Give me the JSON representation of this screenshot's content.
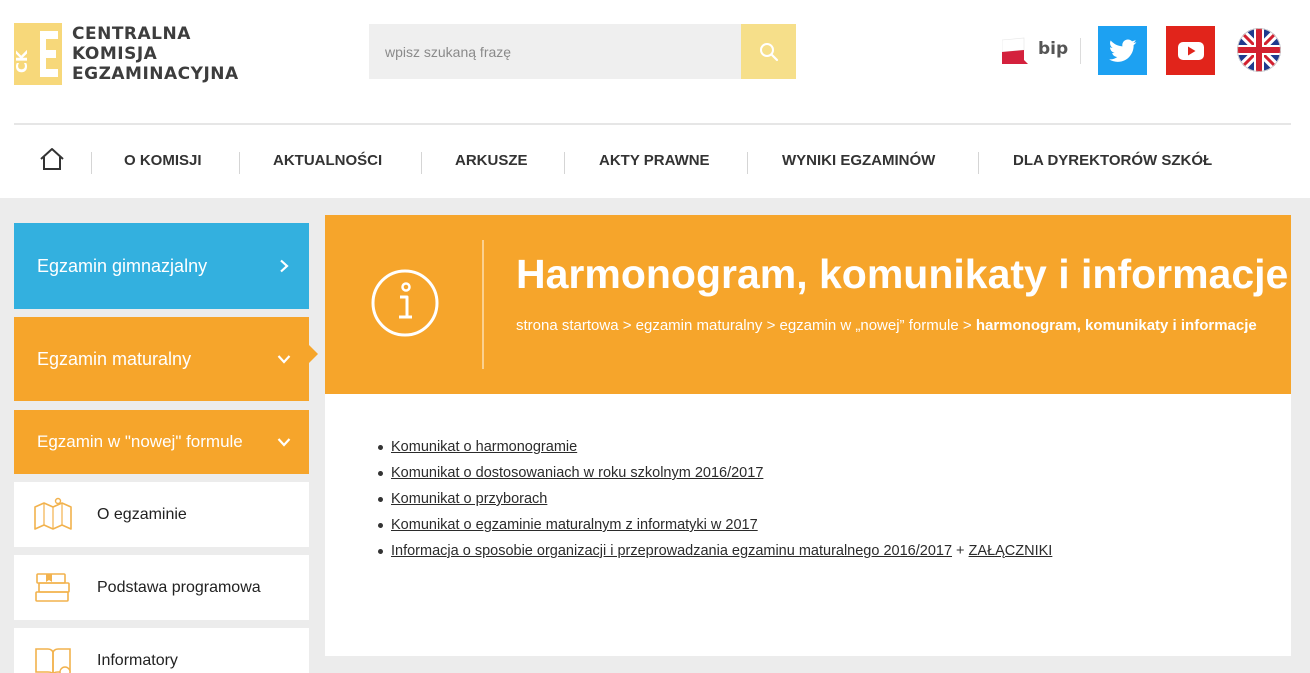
{
  "logo": {
    "mark": "CK",
    "line1": "CENTRALNA",
    "line2": "KOMISJA",
    "line3": "EGZAMINACYJNA",
    "yellow": "#f7d87a"
  },
  "search": {
    "placeholder": "wpisz szukaną frazę",
    "value": "",
    "icon": "search-icon"
  },
  "header_links": {
    "bip_label": "bip",
    "twitter_icon": "twitter-icon",
    "youtube_icon": "youtube-icon",
    "language_icon": "uk-flag-icon"
  },
  "nav": {
    "home_icon": "home-icon",
    "items": [
      {
        "label": "O KOMISJI"
      },
      {
        "label": "AKTUALNOŚCI"
      },
      {
        "label": "ARKUSZE"
      },
      {
        "label": "AKTY PRAWNE"
      },
      {
        "label": "WYNIKI EGZAMINÓW"
      },
      {
        "label": "DLA DYREKTORÓW SZKÓŁ"
      }
    ]
  },
  "sidebar": {
    "items": [
      {
        "label": "Egzamin gimnazjalny",
        "color": "#33b0df",
        "icon": "chevron-right-icon"
      },
      {
        "label": "Egzamin maturalny",
        "color": "#f6a52b",
        "icon": "chevron-down-icon"
      },
      {
        "label": "Egzamin w \"nowej\" formule",
        "color": "#f6a52b",
        "icon": "chevron-down-icon"
      }
    ],
    "subitems": [
      {
        "label": "O egzaminie",
        "icon": "map-icon"
      },
      {
        "label": "Podstawa programowa",
        "icon": "books-icon"
      },
      {
        "label": "Informatory",
        "icon": "book-info-icon"
      }
    ]
  },
  "hero": {
    "title": "Harmonogram, komunikaty i informacje",
    "icon": "info-icon",
    "color": "#f6a52b",
    "breadcrumb": {
      "items": [
        "strona startowa",
        "egzamin maturalny",
        "egzamin w „nowej” formule"
      ],
      "separator": ">",
      "current": "harmonogram, komunikaty i informacje"
    }
  },
  "content": {
    "links": [
      {
        "text": "Komunikat o harmonogramie"
      },
      {
        "text": "Komunikat o dostosowaniach w roku szkolnym 2016/2017"
      },
      {
        "text": "Komunikat o przyborach"
      },
      {
        "text": "Komunikat o egzaminie maturalnym z informatyki w 2017"
      },
      {
        "text": "Informacja o sposobie organizacji i przeprowadzania egzaminu maturalnego 2016/2017",
        "joiner": "+",
        "extra": "ZAŁĄCZNIKI"
      }
    ]
  }
}
